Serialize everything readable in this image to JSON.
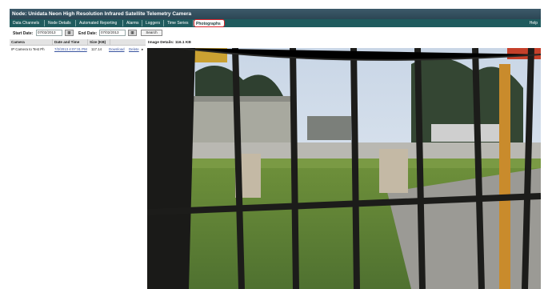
{
  "window": {
    "title": "Node: Unidata Neon High Resolution Infrared Satellite Telemetry Camera"
  },
  "tabs": [
    {
      "label": "Data Channels",
      "active": false
    },
    {
      "label": "Node Details",
      "active": false
    },
    {
      "label": "Automated Reporting",
      "active": false
    },
    {
      "label": "Alarms",
      "active": false
    },
    {
      "label": "Loggers",
      "active": false
    },
    {
      "label": "Time Series",
      "active": false
    },
    {
      "label": "Photographs",
      "active": true
    }
  ],
  "help_label": "Help",
  "toolbar": {
    "start_label": "Start Date:",
    "start_value": "07/02/2013",
    "end_label": "End Date:",
    "end_value": "07/02/2013",
    "button_label": "Search"
  },
  "photo_list": {
    "columns": [
      "Camera",
      "Date and Time",
      "Size (KB)"
    ],
    "rows": [
      {
        "camera": "IP Camera to Test Ph",
        "datetime": "7/2/2013 4:07:31 PM",
        "size": "117.14",
        "download": "Download",
        "delete": "Delete"
      }
    ]
  },
  "image_details": "Image Details: 116.1 KB",
  "colors": {
    "titlebar": "#2c4654",
    "tabbar": "#1f5b5e",
    "highlight": "#d9262c"
  }
}
